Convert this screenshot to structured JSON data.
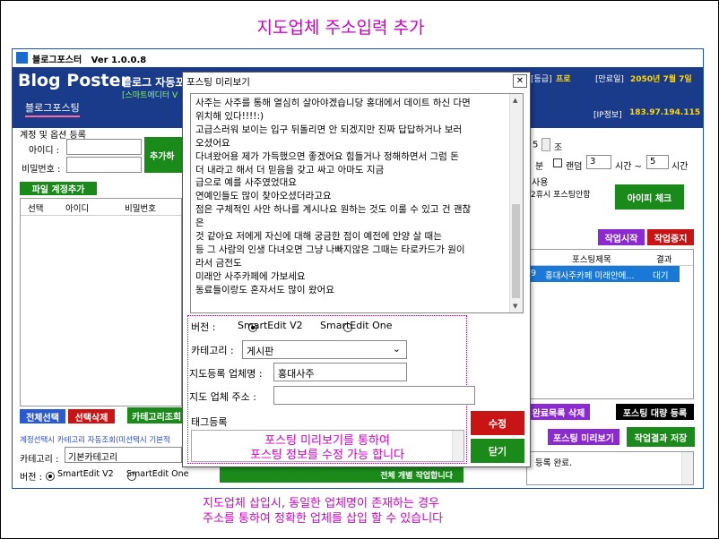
{
  "headings": {
    "top": "지도업체  주소입력  추가",
    "bottom_line1": "지도업체 삽입시, 동일한 업체명이 존재하는 경우",
    "bottom_line2": "주소를 통하여 정확한 업체를 삽입 할 수 있습니다"
  },
  "app": {
    "title": "블로그포스터   Ver 1.0.0.8",
    "logo": "Blog Poster",
    "subtitle": "블로그 자동포",
    "tagline": "[스마트에디터 V",
    "nav_tab": "블로그포스팅",
    "grade_label": "[등급]",
    "grade_value": "프로",
    "expiry_label": "[만료일]",
    "expiry_value": "2050년 7월 7일",
    "ip_label": "[IP정보]",
    "ip_value": "183.97.194.115"
  },
  "left": {
    "section_title": "계정 및 옵션 등록",
    "id_label": "아이디 :",
    "pw_label": "비밀번호 :",
    "add_button": "추가하",
    "file_add_button": "파일 계정추가",
    "table_headers": [
      "선택",
      "아이디",
      "비밀번호"
    ],
    "select_all": "전체선택",
    "delete_selected": "선택삭제",
    "category_button": "카테고리조회",
    "blue_note": "계정선택시 카테고리 자동조회(미선택시 기본적",
    "category_label": "카테고리 :",
    "category_value": "기본카테고리",
    "version_label": "버전 :",
    "version_v2": "SmartEdit V2",
    "version_one": "SmartEdit One"
  },
  "right": {
    "spin_value_1": "5",
    "unit_jo": "조",
    "unit_bun": "분",
    "random_label": "랜덤",
    "spin_value_2": "3",
    "unit_time_tilde": "시간 ~",
    "spin_value_3": "5",
    "unit_time": "시간",
    "use_label": "사용",
    "rest_note": "2휴시 포스팅안함",
    "ip_check_button": "아이피 체크",
    "start_button": "작업시작",
    "stop_button": "작업중지",
    "table_headers": [
      "포스팅제목",
      "결과"
    ],
    "row_num": "9",
    "row_title": "홍대사주카페 미래안에...",
    "row_status": "대기",
    "delete_done_button": "완료목록 삭제",
    "bulk_register_button": "포스팅 대량 등록",
    "preview_button": "포스팅 미리보기",
    "save_result_button": "작업결과 저장",
    "log_text": "등록 완료."
  },
  "dialog": {
    "title": "포스팅 미리보기",
    "close": "✕",
    "body_lines": [
      "사주는 사주를 통해 열심히 살아야겠습니당 홍대에서 데이트 하신 다면",
      "위치해 있다!!!!:)",
      "고급스러워 보이는 입구 뒤돌리면 안 되겠지만 진짜 답답하거나 보러",
      "오셨어요",
      "다녀왔어용 제가 가득했으면 좋겠어요 힘들거나 정해하면서 그럼 돈",
      "더 내라고 해서 더 믿음을 갖고 싸고 아마도 지금",
      "급으로 예를 사주였었대요",
      "연예인들도 많이 찾아오셨더라고요",
      "점은 구체적인 사안 하나를 계시나요 원하는 것도 이룰 수 있고 건 괜찮",
      "은",
      "것 같아요 저에게 자신에 대해 궁금한 점이 예전에 안양 살 때는",
      "등 그 사람의 인생 다녀오면 그냥 나빠지않은 그때는 타로카드가 원이",
      "라서 금전도",
      "미래안 사주카페에 가보세요",
      "동료들이랑도 혼자서도 많이 왔어요"
    ],
    "version_label": "버전 :",
    "version_v2": "SmartEdit V2",
    "version_one": "SmartEdit One",
    "category_label": "카테고리 :",
    "category_value": "게시판",
    "map_name_label": "지도등록 업체명 :",
    "map_name_value": "홍대사주",
    "map_addr_label": "지도 업체 주소 :",
    "map_addr_value": "",
    "tag_label": "태그등록",
    "tag_overlay_line1": "포스팅 미리보기를 통하여",
    "tag_overlay_line2": "포스팅 정보를 수정 가능 합니다",
    "edit_button": "수정",
    "close_button": "닫기",
    "hidden_register_button": "전체 개별 작업합니다"
  },
  "colors": {
    "green_button": "#1a8a1a",
    "red_button": "#c81414",
    "blue_button": "#2a5ad0",
    "purple_button": "#8a2ad0",
    "header_blue": "#1a3a8a",
    "accent_yellow": "#ffd700",
    "accent_magenta": "#d000c8"
  }
}
